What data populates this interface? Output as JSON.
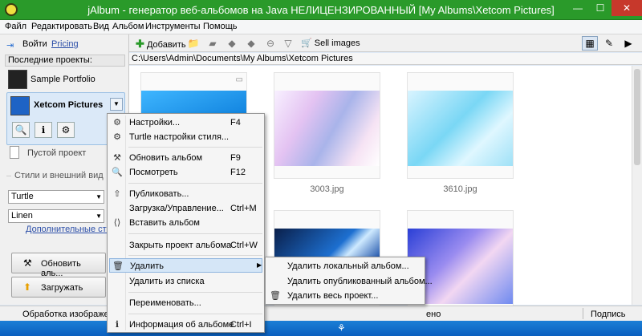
{
  "window": {
    "title": "jAlbum - генератор веб-альбомов на Java НЕЛИЦЕНЗИРОВАННЫЙ [My Albums\\Xetcom Pictures]",
    "minimize": "—",
    "maximize": "☐",
    "close": "✕"
  },
  "menubar": [
    "Файл",
    "Редактировать",
    "Вид",
    "Альбом",
    "Инструменты",
    "Помощь"
  ],
  "sidebar": {
    "login_label": "Войти",
    "pricing_link": "Pricing",
    "recent_header": "Последние проекты:",
    "projects": [
      {
        "name": "Sample Portfolio"
      },
      {
        "name": "Xetcom Pictures"
      }
    ],
    "empty_project": "Пустой проект",
    "styles_header": "Стили и внешний вид",
    "style_select": "Turtle",
    "theme_select": "Linen",
    "advanced_link": "Дополнительные стили",
    "update_button": "Обновить аль...",
    "upload_button": "Загружать"
  },
  "toolbar": {
    "add_label": "Добавить",
    "sell_label": "Sell images"
  },
  "path": "C:\\Users\\Admin\\Documents\\My Albums\\Xetcom Pictures",
  "gallery": {
    "captions": [
      "3003.jpg",
      "3610.jpg"
    ]
  },
  "status": {
    "left": "Обработка изображения",
    "partial": "ено",
    "right": "Подпись"
  },
  "context_menu": {
    "items": [
      {
        "label": "Настройки...",
        "shortcut": "F4",
        "icon": "gear-icon"
      },
      {
        "label": "Turtle настройки стиля...",
        "shortcut": "",
        "icon": "gear-icon"
      },
      {
        "label": "Обновить альбом",
        "shortcut": "F9",
        "icon": "hammer-icon"
      },
      {
        "label": "Посмотреть",
        "shortcut": "F12",
        "icon": "magnifier-icon"
      },
      {
        "label": "Публиковать...",
        "shortcut": "",
        "icon": "upload-arrow-icon"
      },
      {
        "label": "Загрузка/Управление...",
        "shortcut": "Ctrl+M",
        "icon": ""
      },
      {
        "label": "Вставить альбом",
        "shortcut": "",
        "icon": "embed-icon"
      },
      {
        "label": "Закрыть проект альбома",
        "shortcut": "Ctrl+W",
        "icon": ""
      },
      {
        "label": "Удалить",
        "shortcut": "",
        "icon": "trash-icon"
      },
      {
        "label": "Удалить из списка",
        "shortcut": "",
        "icon": ""
      },
      {
        "label": "Переименовать...",
        "shortcut": "",
        "icon": ""
      },
      {
        "label": "Информация об альбоме",
        "shortcut": "Ctrl+I",
        "icon": "info-icon"
      }
    ]
  },
  "submenu": {
    "items": [
      {
        "label": "Удалить локальный альбом..."
      },
      {
        "label": "Удалить опубликованный альбом..."
      },
      {
        "label": "Удалить весь проект...",
        "icon": "trash-icon"
      }
    ]
  }
}
